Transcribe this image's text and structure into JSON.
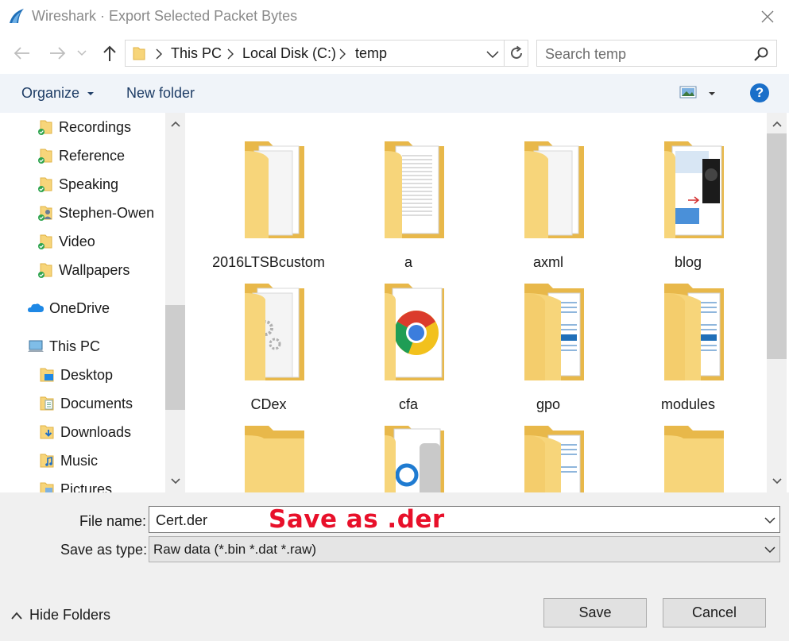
{
  "window": {
    "title": "Wireshark · Export Selected Packet Bytes",
    "icon": "wireshark-fin-icon"
  },
  "address_bar": {
    "breadcrumbs": [
      "This PC",
      "Local Disk (C:)",
      "temp"
    ]
  },
  "search": {
    "placeholder": "Search temp"
  },
  "toolbar": {
    "organize_label": "Organize",
    "new_folder_label": "New folder",
    "help_label": "?"
  },
  "nav_pane": {
    "items": [
      {
        "label": "Recordings",
        "icon": "folder-synced-icon"
      },
      {
        "label": "Reference",
        "icon": "folder-synced-icon"
      },
      {
        "label": "Speaking",
        "icon": "folder-synced-icon"
      },
      {
        "label": "Stephen-Owen",
        "icon": "folder-shared-icon"
      },
      {
        "label": "Video",
        "icon": "folder-synced-icon"
      },
      {
        "label": "Wallpapers",
        "icon": "folder-synced-icon"
      },
      {
        "label": "OneDrive",
        "icon": "onedrive-cloud-icon"
      },
      {
        "label": "This PC",
        "icon": "computer-icon"
      },
      {
        "label": "Desktop",
        "icon": "desktop-folder-icon"
      },
      {
        "label": "Documents",
        "icon": "documents-folder-icon"
      },
      {
        "label": "Downloads",
        "icon": "downloads-folder-icon"
      },
      {
        "label": "Music",
        "icon": "music-folder-icon"
      },
      {
        "label": "Pictures",
        "icon": "pictures-folder-icon"
      }
    ]
  },
  "content": {
    "folders": [
      {
        "name": "2016LTSBcustom",
        "preview": "documents"
      },
      {
        "name": "a",
        "preview": "text-page"
      },
      {
        "name": "axml",
        "preview": "documents"
      },
      {
        "name": "blog",
        "preview": "screenshot"
      },
      {
        "name": "CDex",
        "preview": "gears"
      },
      {
        "name": "cfa",
        "preview": "chrome"
      },
      {
        "name": "gpo",
        "preview": "blue-pages"
      },
      {
        "name": "modules",
        "preview": "blue-pages"
      },
      {
        "name": "",
        "preview": "empty"
      },
      {
        "name": "",
        "preview": "app-page"
      },
      {
        "name": "",
        "preview": "blue-pages"
      },
      {
        "name": "",
        "preview": "empty"
      }
    ]
  },
  "form": {
    "file_name_label": "File name:",
    "file_name_value": "Cert.der",
    "save_as_type_label": "Save as type:",
    "save_as_type_value": "Raw data (*.bin *.dat *.raw)",
    "annotation": "Save as .der"
  },
  "footer": {
    "hide_folders_label": "Hide Folders",
    "save_label": "Save",
    "cancel_label": "Cancel"
  },
  "colors": {
    "folder": "#f7d57a",
    "folder_dark": "#e8b84a",
    "accent_blue": "#1a6fc9",
    "annotation_red": "#e8102a",
    "toolbar_bg": "#f0f4f9"
  }
}
